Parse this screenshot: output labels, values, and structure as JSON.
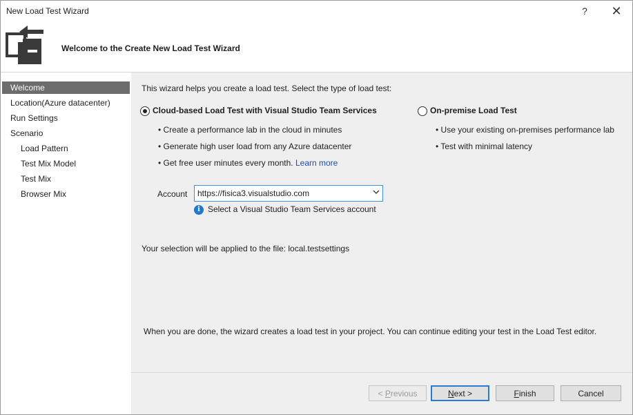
{
  "window": {
    "title": "New Load Test Wizard",
    "help_glyph": "?",
    "close_glyph": "✕"
  },
  "header": {
    "title": "Welcome to the Create New Load Test Wizard",
    "icon": "wizard-doc-icon"
  },
  "sidebar": {
    "items": [
      {
        "label": "Welcome",
        "selected": true,
        "level": 0
      },
      {
        "label": "Location(Azure datacenter)",
        "selected": false,
        "level": 0
      },
      {
        "label": "Run Settings",
        "selected": false,
        "level": 0
      },
      {
        "label": "Scenario",
        "selected": false,
        "level": 0
      },
      {
        "label": "Load Pattern",
        "selected": false,
        "level": 1
      },
      {
        "label": "Test Mix Model",
        "selected": false,
        "level": 1
      },
      {
        "label": "Test Mix",
        "selected": false,
        "level": 1
      },
      {
        "label": "Browser Mix",
        "selected": false,
        "level": 1
      }
    ]
  },
  "main": {
    "intro": "This wizard helps you create a load test. Select the type of load test:",
    "options": {
      "cloud": {
        "label": "Cloud-based Load Test with Visual Studio Team Services",
        "selected": true,
        "bullets": [
          "• Create a performance lab in the cloud in minutes",
          "• Generate high user load from any Azure datacenter",
          "• Get free user minutes every month."
        ],
        "link": "Learn more"
      },
      "onprem": {
        "label": "On-premise Load Test",
        "selected": false,
        "bullets": [
          "• Use your existing on-premises performance lab",
          "• Test with minimal latency"
        ]
      }
    },
    "account": {
      "label": "Account",
      "value": "https://fisica3.visualstudio.com",
      "hint": "Select a Visual Studio Team Services account",
      "info_glyph": "i"
    },
    "selection_note": "Your selection will be applied to the file: local.testsettings",
    "done_note": "When you are done, the wizard creates a load test in your project. You can continue editing your test in the Load Test editor."
  },
  "buttons": {
    "previous": {
      "pre": "< ",
      "key": "P",
      "post": "revious",
      "enabled": false
    },
    "next": {
      "key": "N",
      "post": "ext >",
      "enabled": true
    },
    "finish": {
      "key": "F",
      "post": "inish",
      "enabled": true
    },
    "cancel": {
      "label": "Cancel",
      "enabled": true
    }
  },
  "colors": {
    "sidebar_selected": "#6d6d6d",
    "link": "#1a4fb0",
    "focus_border": "#3a8ee6",
    "info_icon": "#1e78d2"
  }
}
